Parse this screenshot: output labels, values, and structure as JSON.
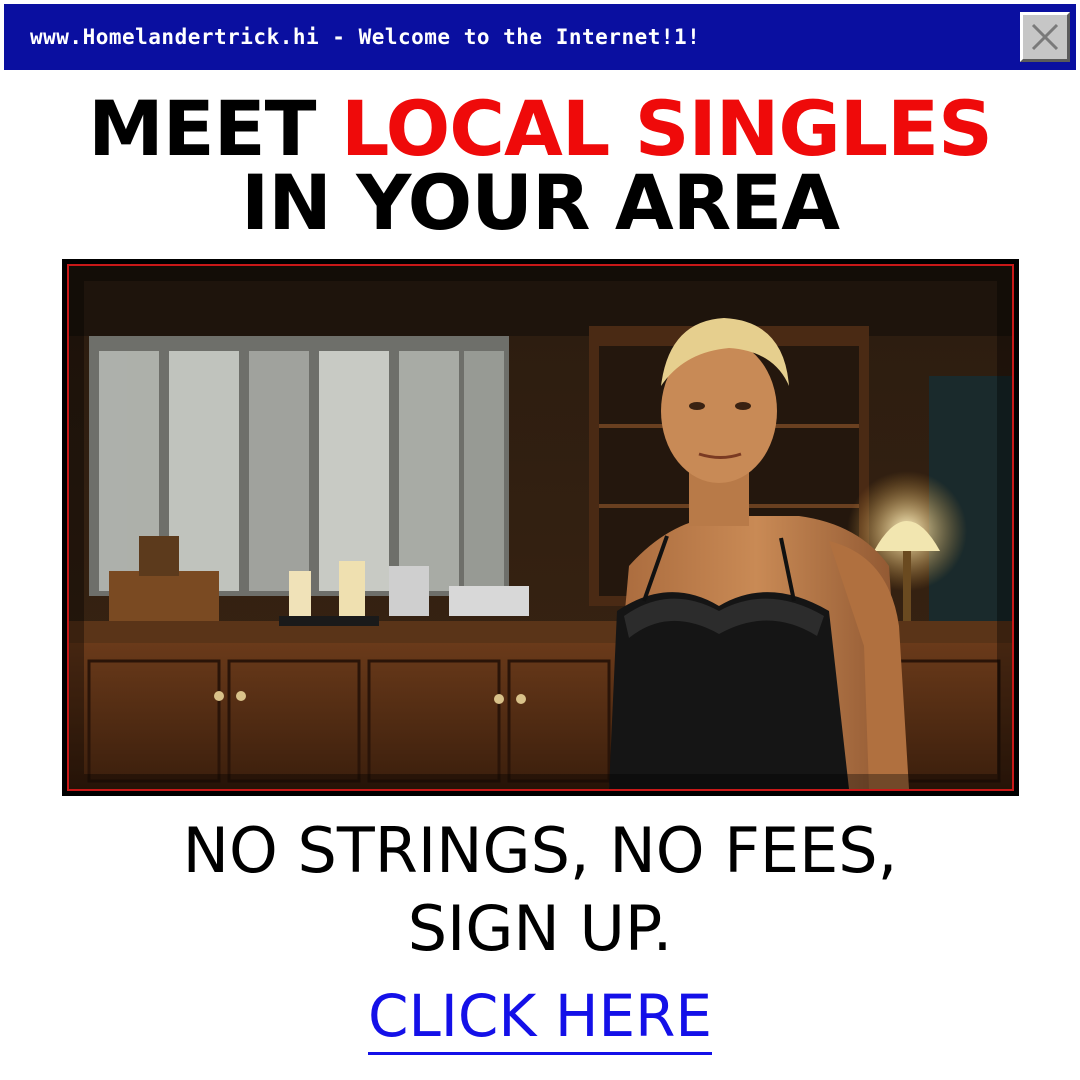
{
  "window": {
    "title": "www.Homelandertrick.hi - Welcome to the Internet!1!",
    "close_icon": "close-x-icon",
    "accent_color": "#0a0fa0"
  },
  "headline": {
    "part1": "MEET",
    "part2": "LOCAL SINGLES",
    "line2": "IN YOUR AREA",
    "highlight_color": "#ef0a0a"
  },
  "photo": {
    "subject": "blond man in black lace slip standing in a wood-panelled kitchen"
  },
  "tagline": {
    "line1": "NO STRINGS, NO FEES,",
    "line2": "SIGN UP."
  },
  "cta": {
    "label": "CLICK HERE",
    "color": "#1410e8"
  }
}
